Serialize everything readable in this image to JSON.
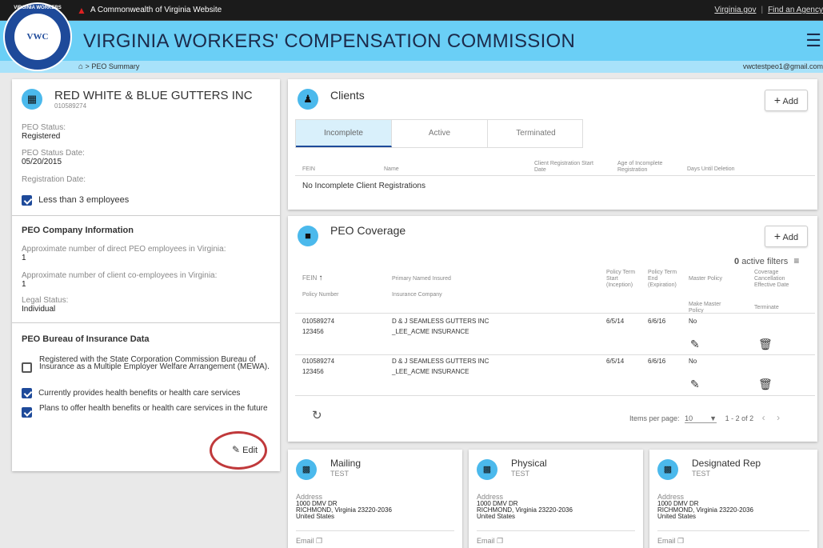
{
  "topbar": {
    "site_text": "A Commonwealth of Virginia Website",
    "link_virginia": "Virginia.gov",
    "link_find": "Find an Agency"
  },
  "header": {
    "title": "VIRGINIA WORKERS' COMPENSATION COMMISSION",
    "seal_text": "VWC",
    "seal_ring": "VIRGINIA WORKERS"
  },
  "breadcrumb": {
    "current": "PEO Summary"
  },
  "user_email": "vwctestpeo1@gmail.com",
  "company": {
    "name": "RED WHITE & BLUE GUTTERS INC",
    "id": "010589274",
    "status_label": "PEO Status:",
    "status": "Registered",
    "status_date_label": "PEO Status Date:",
    "status_date": "05/20/2015",
    "reg_date_label": "Registration Date:",
    "less_than_3": "Less than 3 employees"
  },
  "peo_info": {
    "title": "PEO Company Information",
    "direct_label": "Approximate number of direct PEO employees in Virginia:",
    "direct_value": "1",
    "client_label": "Approximate number of client co-employees in Virginia:",
    "client_value": "1",
    "legal_label": "Legal Status:",
    "legal_value": "Individual"
  },
  "bureau": {
    "title": "PEO Bureau of Insurance Data",
    "items": [
      {
        "text": "Registered with the State Corporation Commission Bureau of Insurance as a Multiple Employer Welfare Arrangement (MEWA).",
        "checked": false
      },
      {
        "text": "Currently provides health benefits or health care services",
        "checked": true
      },
      {
        "text": "Plans to offer health benefits or health care services in the future",
        "checked": true
      }
    ],
    "edit_label": "Edit"
  },
  "clients": {
    "title": "Clients",
    "add_label": "Add",
    "tabs": [
      "Incomplete",
      "Active",
      "Terminated"
    ],
    "columns": [
      "FEIN",
      "Name",
      "Client Registration Start Date",
      "Age of Incomplete Registration",
      "Days Until Deletion"
    ],
    "empty": "No Incomplete Client Registrations"
  },
  "coverage": {
    "title": "PEO Coverage",
    "add_label": "Add",
    "filters_count": "0",
    "filters_label": "active filters",
    "columns": {
      "fein": "FEIN",
      "policy_number": "Policy Number",
      "primary_insured": "Primary Named Insured",
      "insurance_company": "Insurance Company",
      "term_start": "Policy Term Start (Inception)",
      "term_end": "Policy Term End (Expiration)",
      "master_policy": "Master Policy",
      "make_master": "Make Master Policy",
      "cancellation": "Coverage Cancellation Effective Date",
      "terminate": "Terminate"
    },
    "rows": [
      {
        "fein": "010589274",
        "policy": "123456",
        "insured": "D & J SEAMLESS GUTTERS INC",
        "company": "_LEE_ACME INSURANCE",
        "start": "6/5/14",
        "end": "6/6/16",
        "master": "No"
      },
      {
        "fein": "010589274",
        "policy": "123456",
        "insured": "D & J SEAMLESS GUTTERS INC",
        "company": "_LEE_ACME INSURANCE",
        "start": "6/5/14",
        "end": "6/6/16",
        "master": "No"
      }
    ],
    "items_per_page_label": "Items per page:",
    "items_per_page": "10",
    "range": "1 - 2 of 2"
  },
  "addresses": [
    {
      "title": "Mailing",
      "sub": "TEST",
      "addr_label": "Address",
      "line1": "1000 DMV DR",
      "line2": "RICHMOND, Virginia 23220-2036",
      "line3": "United States",
      "email_label": "Email"
    },
    {
      "title": "Physical",
      "sub": "TEST",
      "addr_label": "Address",
      "line1": "1000 DMV DR",
      "line2": "RICHMOND, Virginia 23220-2036",
      "line3": "United States",
      "email_label": "Email"
    },
    {
      "title": "Designated Rep",
      "sub": "TEST",
      "addr_label": "Address",
      "line1": "1000 DMV DR",
      "line2": "RICHMOND, Virginia 23220-2036",
      "line3": "United States",
      "email_label": "Email"
    }
  ],
  "colors": {
    "header": "#6acff6",
    "accent": "#4bb9ec",
    "annotation_circle": "#c0393b"
  }
}
